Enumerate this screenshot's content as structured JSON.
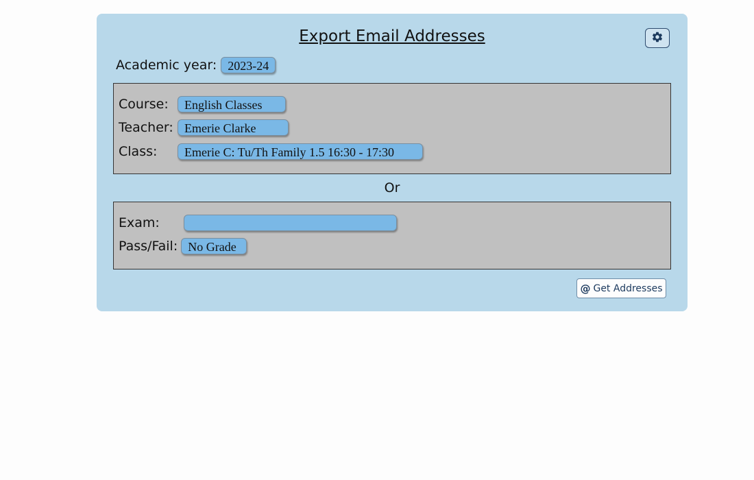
{
  "page": {
    "title": "Export Email Addresses"
  },
  "academic_year": {
    "label": "Academic year:",
    "value": "2023-24"
  },
  "course_box": {
    "course": {
      "label": "Course:",
      "value": "English Classes"
    },
    "teacher": {
      "label": "Teacher:",
      "value": "Emerie Clarke"
    },
    "class": {
      "label": "Class:",
      "value": "Emerie C: Tu/Th Family 1.5 16:30 - 17:30"
    }
  },
  "separator": "Or",
  "exam_box": {
    "exam": {
      "label": "Exam:",
      "value": ""
    },
    "passfail": {
      "label": "Pass/Fail:",
      "value": "No Grade"
    }
  },
  "actions": {
    "get_addresses_label": "Get Addresses"
  },
  "icons": {
    "settings": "gear-icon",
    "get_addresses": "at-icon"
  },
  "colors": {
    "panel_bg": "#b8d8ea",
    "box_bg": "#c0c0c0",
    "pill_bg": "#7ab8e6"
  }
}
